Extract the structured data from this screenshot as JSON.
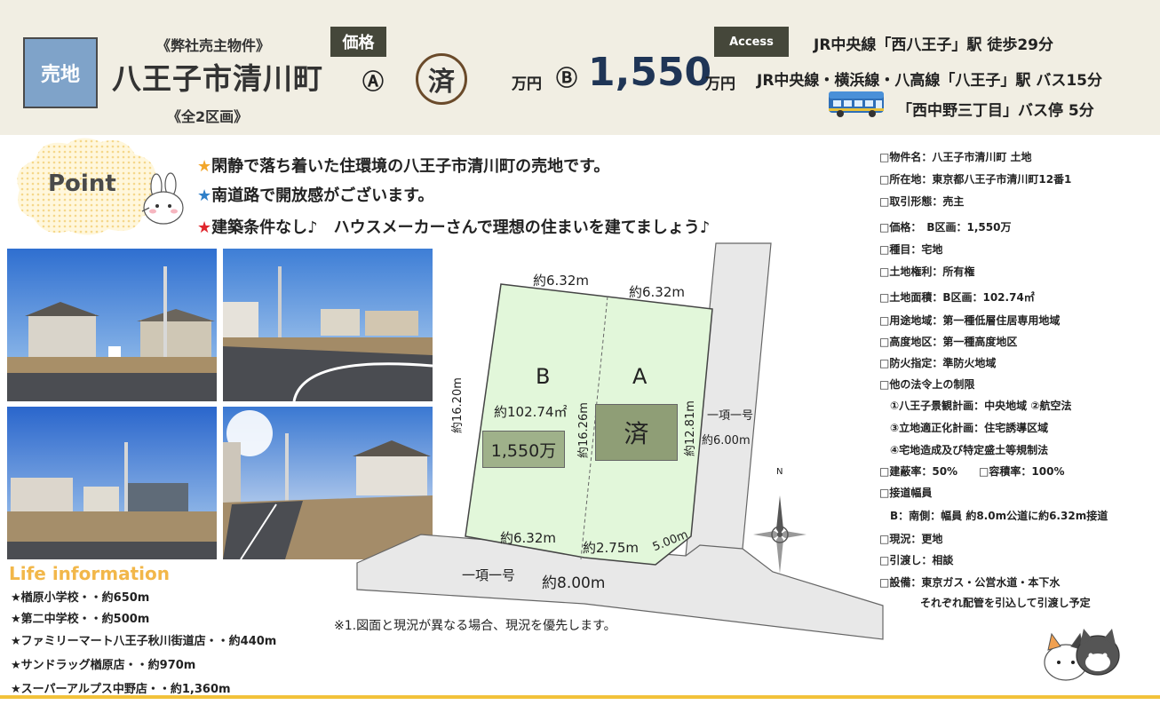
{
  "header": {
    "badge": "売地",
    "subtitle_top": "《弊社売主物件》",
    "title": "八王子市清川町",
    "subtitle_bottom": "《全2区画》",
    "price_tag": "価格",
    "lot_a_mark": "Ⓐ",
    "sold_mark": "済",
    "man_yen_1": "万円",
    "lot_b_mark": "Ⓑ",
    "price_b": "1,550",
    "man_yen_2": "万円",
    "access_tag": "Access",
    "access_lines": [
      "JR中央線「西八王子」駅 徒歩29分",
      "JR中央線・横浜線・八高線「八王子」駅 バス15分",
      "「西中野三丁目」バス停 5分"
    ]
  },
  "point": {
    "label": "Point",
    "lines": [
      {
        "star": "★",
        "text": "閑静で落ち着いた住環境の八王子市清川町の売地です。"
      },
      {
        "star": "★",
        "text": "南道路で開放感がございます。"
      },
      {
        "star": "★",
        "text": "建築条件なし♪　ハウスメーカーさんで理想の住まいを建てましょう♪"
      }
    ]
  },
  "map": {
    "top_left_dim": "約6.32m",
    "top_right_dim": "約6.32m",
    "lot_b_label": "B",
    "lot_a_label": "A",
    "lot_b_area": "約102.74㎡",
    "lot_b_price": "1,550万",
    "lot_a_status": "済",
    "left_depth": "約16.20m",
    "mid_depth": "約16.26m",
    "right_depth": "約12.81m",
    "east_road_name": "一項一号",
    "east_road_width": "約6.00m",
    "bottom_left_dim": "約6.32m",
    "bottom_mid_dim": "約2.75m",
    "corner_dim": "5.00m",
    "south_road_name": "一項一号",
    "south_road_width": "約8.00m",
    "compass_n": "N"
  },
  "note": "※1.図面と現況が異なる場合、現況を優先します。",
  "life": {
    "title": "Life information",
    "items": [
      "★楢原小学校・・約650m",
      "★第二中学校・・約500m",
      "★ファミリーマート八王子秋川街道店・・約440m",
      "★サンドラッグ楢原店・・約970m",
      "★スーパーアルプス中野店・・約1,360m"
    ]
  },
  "info": [
    "□物件名：八王子市清川町 土地",
    "□所在地：東京都八王子市清川町12番1",
    "□取引形態：売主",
    "□価格：　B区画：1,550万",
    "□種目：宅地",
    "□土地権利：所有権",
    "□土地面積：B区画：102.74㎡",
    "□用途地域：第一種低層住居専用地域",
    "□高度地区：第一種高度地区",
    "□防火指定：準防火地域",
    "□他の法令上の制限",
    "①八王子景観計画：中央地域 ②航空法",
    "③立地適正化計画：住宅誘導区域",
    "④宅地造成及び特定盛土等規制法",
    "□建蔽率：50%　　□容積率：100%",
    "□接道幅員",
    "B：南側：幅員 約8.0m公道に約6.32m接道",
    "□現況：更地",
    "□引渡し：相談",
    "□設備：東京ガス・公営水道・本下水",
    "それぞれ配管を引込して引渡し予定"
  ],
  "colors": {
    "header_bg": "#f1eee3",
    "badge_bg": "#7fa3c9",
    "tag_bg": "#45473a",
    "price_color": "#1f3556",
    "lot_fill": "#e2f7da",
    "road_fill": "#e8e8e8",
    "life_title": "#f2b74a",
    "accent_line": "#f2c23a"
  }
}
